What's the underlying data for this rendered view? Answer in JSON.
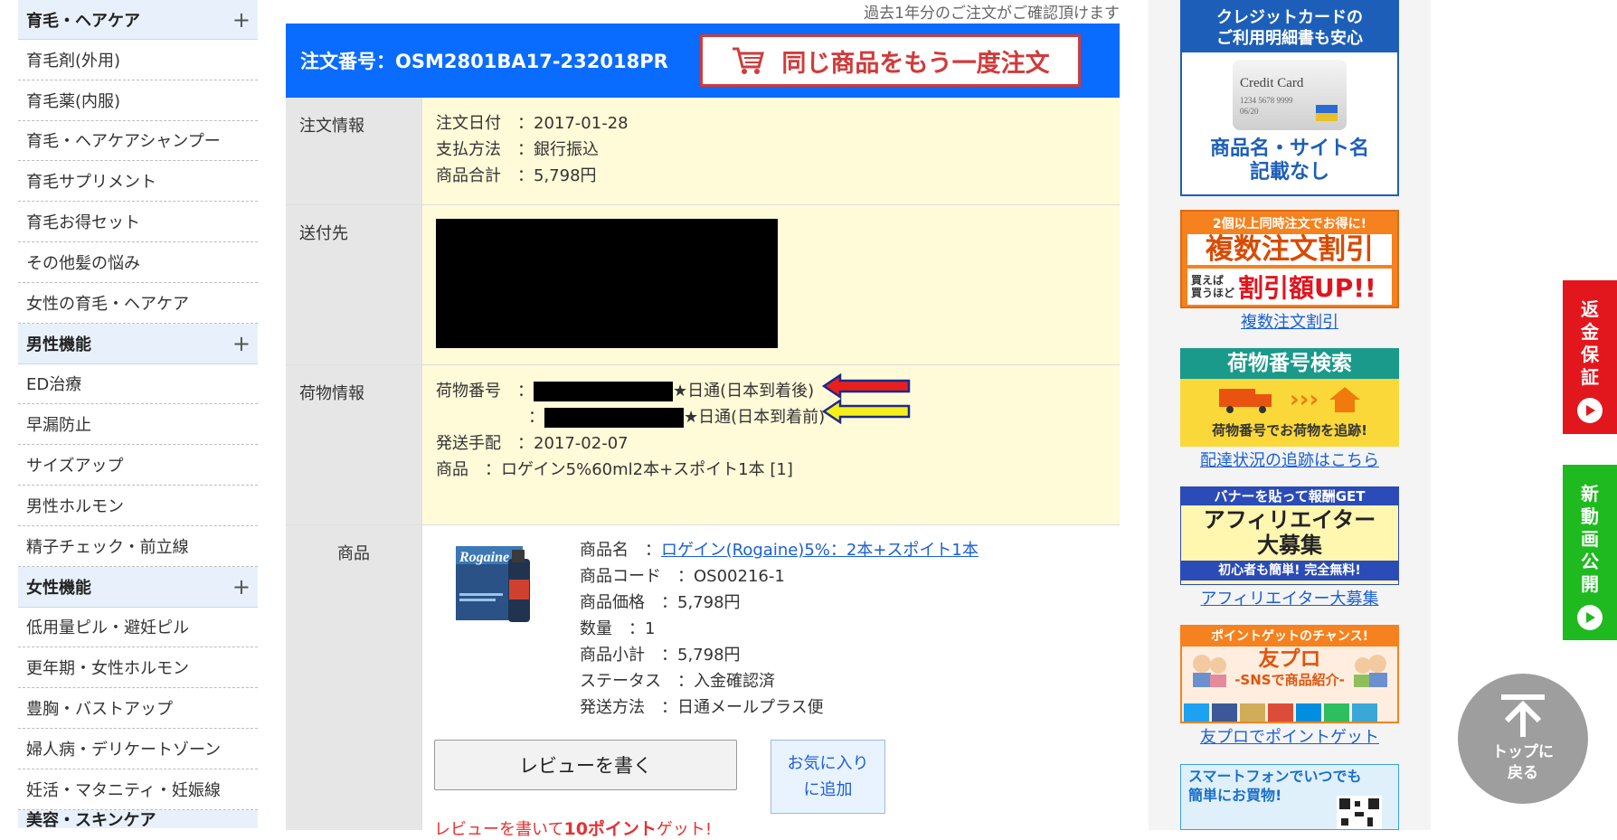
{
  "sidebar": {
    "groups": [
      {
        "title": "育毛・ヘアケア",
        "items": [
          "育毛剤(外用)",
          "育毛薬(内服)",
          "育毛・ヘアケアシャンプー",
          "育毛サプリメント",
          "育毛お得セット",
          "その他髪の悩み",
          "女性の育毛・ヘアケア"
        ]
      },
      {
        "title": "男性機能",
        "items": [
          "ED治療",
          "早漏防止",
          "サイズアップ",
          "男性ホルモン",
          "精子チェック・前立線"
        ]
      },
      {
        "title": "女性機能",
        "items": [
          "低用量ピル・避妊ピル",
          "更年期・女性ホルモン",
          "豊胸・バストアップ",
          "婦人病・デリケートゾーン",
          "妊活・マタニティ・妊娠線"
        ]
      }
    ],
    "cut_group": "美容・スキンケア",
    "plus": "+"
  },
  "notice": "過去1年分のご注文がご確認頂けます",
  "order": {
    "number_label": "注文番号：OSM2801BA17-232018PR",
    "reorder_button": "同じ商品をもう一度注文"
  },
  "order_info": {
    "label": "注文情報",
    "date": "注文日付　：2017-01-28",
    "payment": "支払方法　：銀行振込",
    "total": "商品合計　：5,798円"
  },
  "shipping": {
    "label": "送付先"
  },
  "package": {
    "label": "荷物情報",
    "tracking_label": "荷物番号　：",
    "colon": "：",
    "line1_suffix": "★日通(日本到着後)",
    "line2_suffix": "★日通(日本到着前)",
    "ship_date": "発送手配　：2017-02-07",
    "item": "商品　：ロゲイン5%60ml2本+スポイト1本 [1]"
  },
  "product": {
    "label": "商品",
    "name_label": "商品名　：",
    "name_link": "ロゲイン(Rogaine)5%：2本+スポイト1本",
    "code": "商品コード　：OS00216-1",
    "price": "商品価格　：5,798円",
    "qty": "数量　：1",
    "subtotal": "商品小計　：5,798円",
    "status": "ステータス　：入金確認済",
    "method": "発送方法　：日通メールプラス便",
    "image_brand": "Rogaine",
    "review_button": "レビューを書く",
    "fav_button_1": "お気に入り",
    "fav_button_2": "に追加",
    "review_note_pre": "レビューを書いて",
    "review_note_pts": "10ポイント",
    "review_note_post": "ゲット!"
  },
  "banners": {
    "credit": {
      "line1": "クレジットカードの",
      "line2": "ご利用明細書も安心",
      "card_text": "Credit Card",
      "card_num": "1234 5678 9999",
      "card_exp": "06/20",
      "line3": "商品名・サイト名",
      "line4": "記載なし"
    },
    "multi": {
      "top": "2個以上同時注文でお得に!",
      "big": "複数注文割引",
      "small1": "買えば",
      "small2": "買うほど",
      "up": "割引額UP!!",
      "link": "複数注文割引"
    },
    "tracking": {
      "title": "荷物番号検索",
      "sub": "荷物番号でお荷物を追跡!",
      "link": "配達状況の追跡はこちら"
    },
    "affiliate": {
      "top": "バナーを貼って報酬GET",
      "big1": "アフィリエイター",
      "big2": "大募集",
      "bottom": "初心者も簡単! 完全無料!",
      "link": "アフィリエイター大募集"
    },
    "tomopro": {
      "top": "ポイントゲットのチャンス!",
      "big": "友プロ",
      "sub": "-SNSで商品紹介-",
      "link": "友プロでポイントゲット"
    },
    "smartphone": {
      "line1": "スマートフォンでいつでも",
      "line2": "簡単にお買物!"
    }
  },
  "side_tabs": {
    "refund": [
      "返",
      "金",
      "保",
      "証"
    ],
    "video": [
      "新",
      "動",
      "画",
      "公",
      "開"
    ]
  },
  "to_top": {
    "line1": "トップに",
    "line2": "戻る"
  },
  "colors": {
    "accent_blue": "#0a6bff",
    "red": "#d23a3a",
    "cream": "#fffbd8",
    "green": "#1fba1f"
  }
}
